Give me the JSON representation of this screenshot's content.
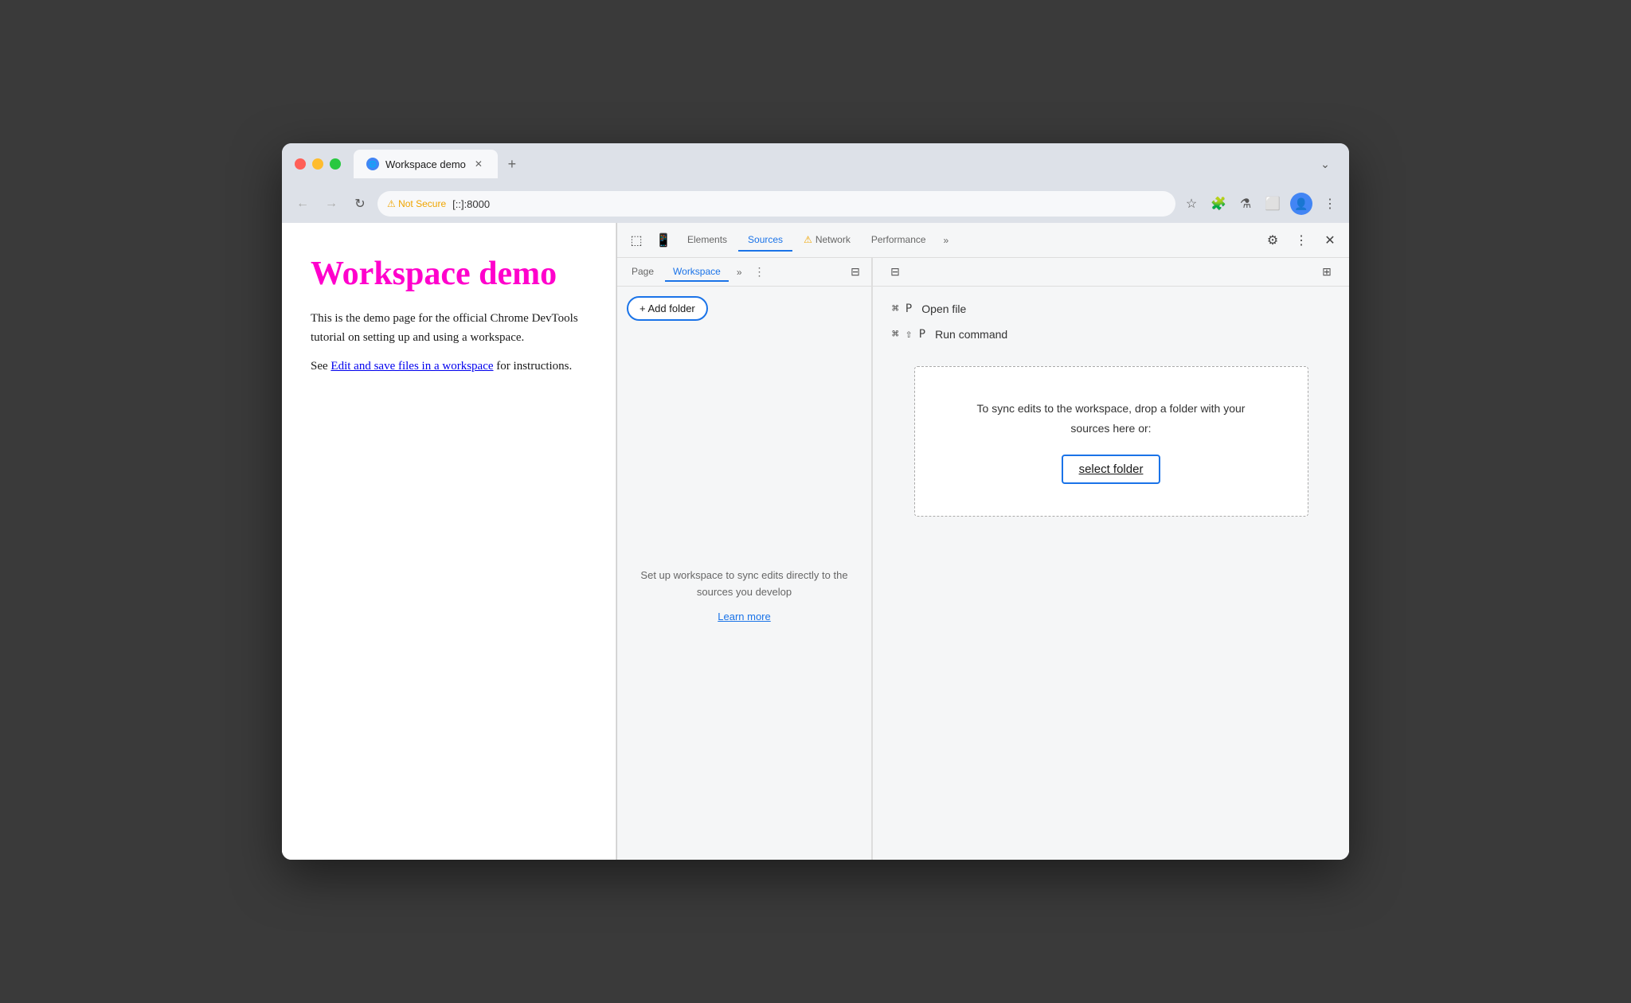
{
  "browser": {
    "tab": {
      "title": "Workspace demo",
      "favicon_label": "globe"
    },
    "new_tab_label": "+",
    "address_bar": {
      "security_warning": "⚠ Not Secure",
      "url": "[::]:8000"
    },
    "nav": {
      "back": "←",
      "forward": "→",
      "reload": "↻",
      "more": "⋮",
      "chevron": "⌄"
    },
    "toolbar_icons": [
      "☆",
      "🧩",
      "⚗",
      "⬜",
      "👤",
      "⋮"
    ]
  },
  "webpage": {
    "title": "Workspace demo",
    "description": "This is the demo page for the official Chrome DevTools tutorial on setting up and using a workspace.",
    "link_prefix": "See ",
    "link_text": "Edit and save files in a workspace",
    "link_suffix": " for instructions."
  },
  "devtools": {
    "toolbar": {
      "tabs": [
        "Elements",
        "Sources",
        "Network",
        "Performance"
      ],
      "more_label": "»",
      "active_tab": "Sources",
      "warning_tab": "Network",
      "warning_icon": "⚠"
    },
    "sources": {
      "sidebar_tabs": [
        "Page",
        "Workspace"
      ],
      "active_sidebar_tab": "Workspace",
      "more_label": "»",
      "menu_icon": "⋮",
      "toggle_icon": "⊟",
      "add_folder_label": "+ Add folder",
      "hint_text": "Set up workspace to sync edits directly to the sources you develop",
      "learn_more_label": "Learn more",
      "right_toggle_icon": "⊞"
    },
    "main": {
      "shortcuts": [
        {
          "keys": "⌘ P",
          "action": "Open file"
        },
        {
          "keys": "⌘ ⇧ P",
          "action": "Run command"
        }
      ],
      "drop_zone_text": "To sync edits to the workspace, drop a folder with your sources here or:",
      "select_folder_label": "select folder"
    }
  }
}
